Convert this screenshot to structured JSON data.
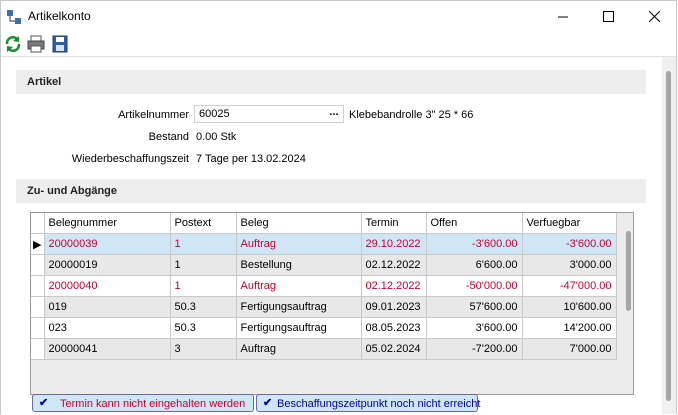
{
  "window": {
    "title": "Artikelkonto"
  },
  "toolbar": {
    "refresh_icon": "refresh-icon",
    "print_icon": "print-icon",
    "save_icon": "save-icon"
  },
  "artikel": {
    "section_title": "Artikel",
    "artikelnummer_label": "Artikelnummer",
    "artikelnummer_value": "60025",
    "browse_label": "...",
    "artikel_bezeichnung": "Klebebandrolle 3\" 25 * 66",
    "bestand_label": "Bestand",
    "bestand_value": "0.00 Stk",
    "wbz_label": "Wiederbeschaffungszeit",
    "wbz_value": "7 Tage per 13.02.2024"
  },
  "zuab": {
    "section_title": "Zu- und Abgänge",
    "columns": [
      "Belegnummer",
      "Postext",
      "Beleg",
      "Termin",
      "Offen",
      "Verfuegbar"
    ],
    "rows": [
      {
        "cells": [
          "20000039",
          "1",
          "Auftrag",
          "29.10.2022",
          "-3'600.00",
          "-3'600.00"
        ],
        "status": "late",
        "selected": true
      },
      {
        "cells": [
          "20000019",
          "1",
          "Bestellung",
          "02.12.2022",
          "6'600.00",
          "3'000.00"
        ],
        "status": "normal",
        "selected": false
      },
      {
        "cells": [
          "20000040",
          "1",
          "Auftrag",
          "02.12.2022",
          "-50'000.00",
          "-47'000.00"
        ],
        "status": "late",
        "selected": false
      },
      {
        "cells": [
          "019",
          "50.3",
          "Fertigungsauftrag",
          "09.01.2023",
          "57'600.00",
          "10'600.00"
        ],
        "status": "normal",
        "selected": false
      },
      {
        "cells": [
          "023",
          "50.3",
          "Fertigungsauftrag",
          "08.05.2023",
          "3'600.00",
          "14'200.00"
        ],
        "status": "normal",
        "selected": false
      },
      {
        "cells": [
          "20000041",
          "3",
          "Auftrag",
          "05.02.2024",
          "-7'200.00",
          "7'000.00"
        ],
        "status": "normal",
        "selected": false
      }
    ]
  },
  "legend": {
    "late_label": "Termin kann nicht eingehalten werden",
    "procurement_label": "Beschaffungszeitpunkt noch nicht erreicht"
  },
  "colors": {
    "late_text": "#c8002d",
    "selection": "#cfe6f7"
  }
}
